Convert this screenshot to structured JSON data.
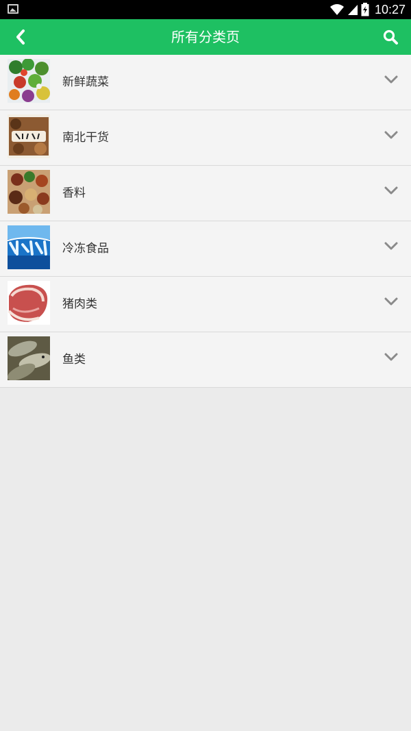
{
  "status_bar": {
    "time": "10:27",
    "icons": [
      "gallery-icon",
      "wifi-icon",
      "signal-icon",
      "battery-icon"
    ]
  },
  "app_bar": {
    "title": "所有分类页",
    "back_icon": "chevron-left-icon",
    "search_icon": "search-icon",
    "background_color": "#1ec062"
  },
  "categories": [
    {
      "label": "新鲜蔬菜",
      "image": "vegetables-photo"
    },
    {
      "label": "南北干货",
      "image": "dried-goods-photo"
    },
    {
      "label": "香料",
      "image": "spices-photo"
    },
    {
      "label": "冷冻食品",
      "image": "frozen-food-photo"
    },
    {
      "label": "猪肉类",
      "image": "pork-photo"
    },
    {
      "label": "鱼类",
      "image": "fish-photo"
    }
  ]
}
